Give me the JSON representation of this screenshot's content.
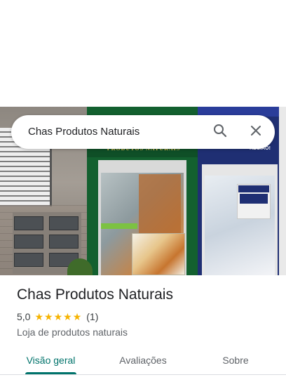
{
  "search": {
    "query": "Chas Produtos Naturais"
  },
  "photo": {
    "brand_text": "PRODUTOS NATURAIS",
    "right_store_text": "REGIÃO!"
  },
  "place": {
    "name": "Chas Produtos Naturais",
    "rating": "5,0",
    "stars": [
      "★",
      "★",
      "★",
      "★",
      "★"
    ],
    "review_count": "(1)",
    "category": "Loja de produtos naturais"
  },
  "tabs": [
    {
      "label": "Visão geral",
      "active": true
    },
    {
      "label": "Avaliações",
      "active": false
    },
    {
      "label": "Sobre",
      "active": false
    }
  ],
  "colors": {
    "accent": "#00736b",
    "star": "#f6b300"
  },
  "icons": {
    "search": "search-icon",
    "close": "close-icon"
  }
}
